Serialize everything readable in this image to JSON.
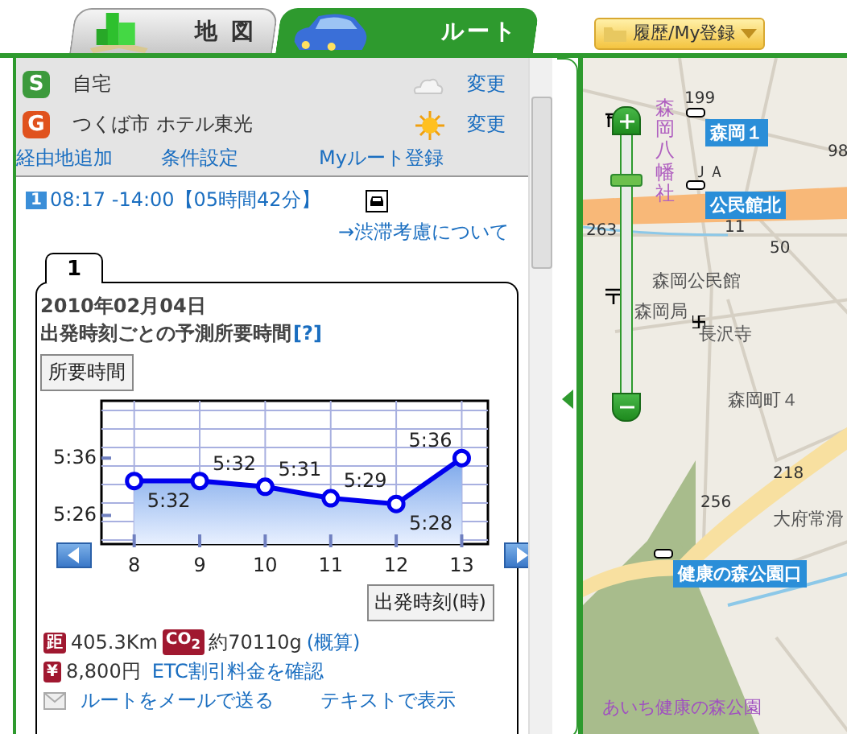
{
  "tabs": [
    {
      "label": "地 図",
      "selected": false
    },
    {
      "label": "ルート",
      "selected": true
    }
  ],
  "history_button": {
    "label": "履歴/My登録"
  },
  "route_points": [
    {
      "marker": "S",
      "color": "#3c9a3c",
      "name": "自宅",
      "kind": "cloudy",
      "action": "変更"
    },
    {
      "marker": "G",
      "color": "#e0521e",
      "name": "つくば市 ホテル東光",
      "kind": "sunny",
      "action": "変更"
    }
  ],
  "route_links": [
    "経由地追加",
    "条件設定",
    "Myルート登録"
  ],
  "route_summary": {
    "index": "1",
    "time": "08:17 -14:00【05時間42分】",
    "congestion_link": "→渋滞考慮について"
  },
  "day_tabs": [
    {
      "label": "1",
      "selected": true
    }
  ],
  "forecast": {
    "date": "2010年02月04日",
    "title": "出発時刻ごとの予測所要時間",
    "help": "[?]",
    "y_button": "所要時間",
    "x_button": "出発時刻(時)",
    "chart_data": {
      "type": "area",
      "x": [
        8,
        9,
        10,
        11,
        12,
        13
      ],
      "series": [
        {
          "color": "#0000ee",
          "values": [
            332,
            332,
            331,
            329,
            328,
            336
          ]
        }
      ],
      "xlim": [
        7.5,
        13.4
      ],
      "ylim": [
        321,
        346
      ],
      "xticks": [
        8,
        9,
        10,
        11,
        12,
        13
      ],
      "yticks": [
        {
          "value": 326,
          "label": "5:26"
        },
        {
          "value": 336,
          "label": "5:36"
        }
      ],
      "grid": true,
      "value_labels": [
        "5:32",
        "5:32",
        "5:31",
        "5:29",
        "5:28",
        "5:36"
      ]
    }
  },
  "stats": [
    {
      "badge": "距",
      "text": "405.3Km"
    },
    {
      "badge": "CO$_{2}$",
      "text": "約70110g",
      "link": "(概算)"
    },
    {
      "badge": "¥",
      "text": "8,800円",
      "link": "ETC割引料金を確認"
    }
  ],
  "bottom_links": [
    "ルートをメールで送る",
    "テキストで表示"
  ],
  "map": {
    "zoom": {
      "level": 0.85
    },
    "labels": [
      {
        "kind": "number",
        "text": "199"
      },
      {
        "kind": "bus_stop",
        "text": "森岡１"
      },
      {
        "kind": "number",
        "text": "98"
      },
      {
        "kind": "shrine",
        "text": "森岡八幡社"
      },
      {
        "kind": "number",
        "text": "ＪＡ"
      },
      {
        "kind": "number",
        "text": "263"
      },
      {
        "kind": "bus_stop",
        "text": "公民館北"
      },
      {
        "kind": "number",
        "text": "11"
      },
      {
        "kind": "number",
        "text": "50"
      },
      {
        "kind": "place",
        "text": "森岡公民館"
      },
      {
        "kind": "place",
        "text": "森岡局"
      },
      {
        "kind": "place",
        "text": "長沢寺"
      },
      {
        "kind": "place",
        "text": "森岡町４"
      },
      {
        "kind": "number",
        "text": "218"
      },
      {
        "kind": "number",
        "text": "256"
      },
      {
        "kind": "place",
        "text": "大府常滑"
      },
      {
        "kind": "bus_stop",
        "text": "健康の森公園口"
      },
      {
        "kind": "park",
        "text": "あいち健康の森公園"
      }
    ]
  }
}
